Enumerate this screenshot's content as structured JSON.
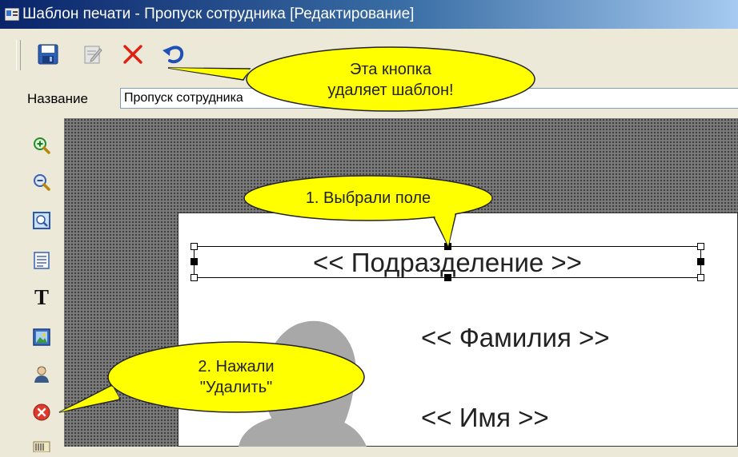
{
  "window": {
    "title": "Шаблон печати - Пропуск сотрудника [Редактирование]"
  },
  "toolbar": {
    "buttons": [
      {
        "name": "save",
        "icon": "save-icon"
      },
      {
        "name": "edit",
        "icon": "edit-icon"
      },
      {
        "name": "delete",
        "icon": "delete-icon"
      },
      {
        "name": "undo",
        "icon": "undo-icon"
      }
    ]
  },
  "name_row": {
    "label": "Название",
    "value": "Пропуск сотрудника"
  },
  "left_tools": [
    {
      "icon": "zoom-in-icon"
    },
    {
      "icon": "zoom-out-icon"
    },
    {
      "icon": "zoom-fit-icon"
    },
    {
      "icon": "text-block-icon"
    },
    {
      "icon": "text-tool-icon",
      "glyph": "T"
    },
    {
      "icon": "image-tool-icon"
    },
    {
      "icon": "photo-tool-icon"
    },
    {
      "icon": "delete-field-icon"
    },
    {
      "icon": "barcode-tool-icon"
    }
  ],
  "card": {
    "department": "<< Подразделение >>",
    "surname": "<< Фамилия >>",
    "firstname": "<< Имя >>"
  },
  "callouts": {
    "toolbar_delete": {
      "line1": "Эта кнопка",
      "line2": "удаляет шаблон!"
    },
    "selected_field": {
      "line1": "1. Выбрали поле"
    },
    "pressed_delete": {
      "line1": "2. Нажали",
      "line2": "\"Удалить\""
    }
  },
  "colors": {
    "callout_fill": "#ffff00",
    "titlebar": "#0a246a",
    "canvas": "#7a7a7a"
  }
}
